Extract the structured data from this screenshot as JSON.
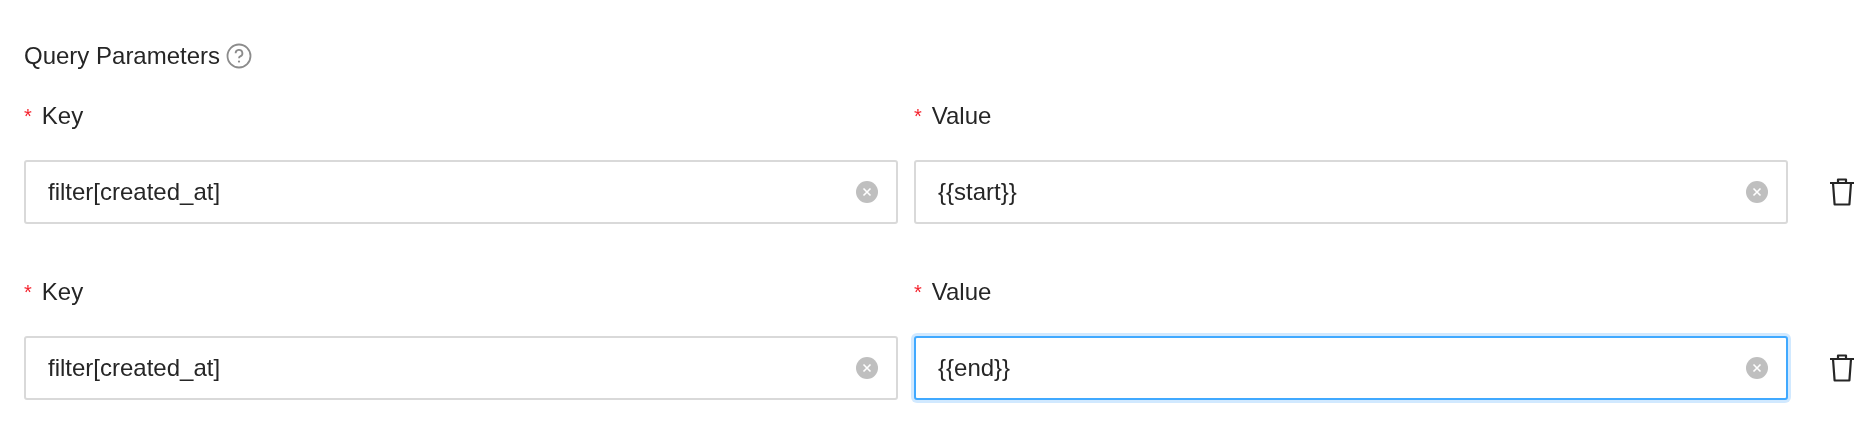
{
  "section": {
    "title": "Query Parameters"
  },
  "params": [
    {
      "key_mark": "*",
      "key_label": "Key",
      "key_value": "filter[created_at]",
      "key_focused": false,
      "value_mark": "*",
      "value_label": "Value",
      "value_value": "{{start}}",
      "value_focused": false
    },
    {
      "key_mark": "*",
      "key_label": "Key",
      "key_value": "filter[created_at]",
      "key_focused": false,
      "value_mark": "*",
      "value_label": "Value",
      "value_value": "{{end}}",
      "value_focused": true
    }
  ]
}
